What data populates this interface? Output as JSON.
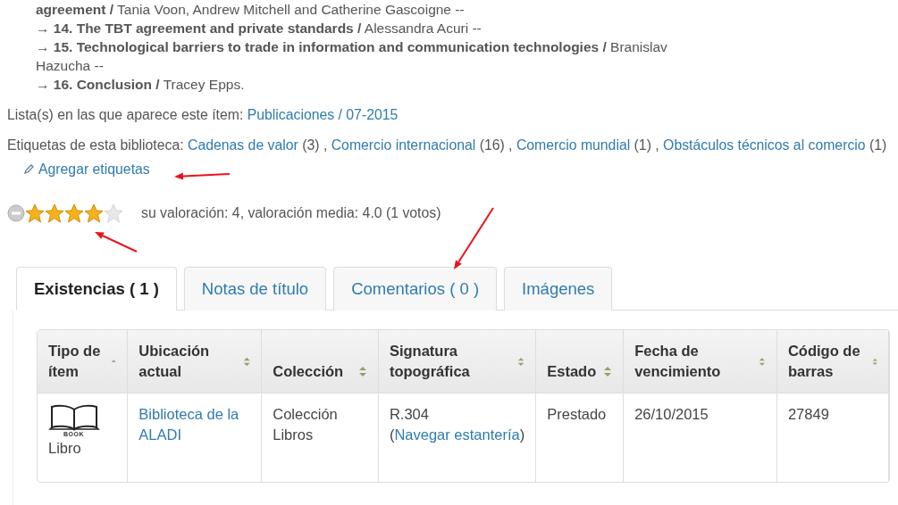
{
  "contents": [
    {
      "text": "**agreement /** Tania Voon, Andrew Mitchell and Catherine Gascoigne --"
    },
    {
      "text": "→ **14. The TBT agreement and private standards /** Alessandra Acuri --"
    },
    {
      "text": "→ **15. Technological barriers to trade in information and communication technologies /** Branislav Hazucha --"
    },
    {
      "text": "→ **16. Conclusion /** Tracey Epps."
    }
  ],
  "lists": {
    "label": "Lista(s) en las que aparece este ítem:",
    "link": "Publicaciones / 07-2015"
  },
  "tags": {
    "label": "Etiquetas de esta biblioteca:",
    "items": [
      {
        "name": "Cadenas de valor",
        "count": "(3) ,"
      },
      {
        "name": "Comercio internacional",
        "count": "(16) ,"
      },
      {
        "name": "Comercio mundial",
        "count": "(1) ,"
      },
      {
        "name": "Obstáculos técnicos al comercio",
        "count": "(1)"
      }
    ],
    "add_link": "Agregar etiquetas"
  },
  "rating": {
    "stars": 4,
    "text": "su valoración: 4, valoración media: 4.0 (1 votos)"
  },
  "tabs": [
    {
      "label": "Existencias ( 1 )",
      "selected": true
    },
    {
      "label": "Notas de título",
      "selected": false
    },
    {
      "label": "Comentarios ( 0 )",
      "selected": false
    },
    {
      "label": "Imágenes",
      "selected": false
    }
  ],
  "table": {
    "columns": [
      {
        "label": "Tipo de ítem",
        "sorted": true
      },
      {
        "label": "Ubicación actual",
        "sorted": false
      },
      {
        "label": "Colección",
        "sorted": false
      },
      {
        "label": "Signatura topográfica",
        "sorted": false
      },
      {
        "label": "Estado",
        "sorted": false
      },
      {
        "label": "Fecha de vencimiento",
        "sorted": false
      },
      {
        "label": "Código de barras",
        "sorted": false
      }
    ],
    "rows": [
      {
        "icon_label": "BOOK",
        "item_type": "Libro",
        "location": "Biblioteca de la ALADI",
        "collection": "Colección Libros",
        "call_number_prefix": "R.304 (",
        "browse_link": "Navegar estantería",
        "call_number_suffix": ")",
        "status": "Prestado",
        "due_date": "26/10/2015",
        "barcode": "27849"
      }
    ]
  },
  "annotation_arrows": [
    {
      "kind": "left"
    },
    {
      "kind": "up-left"
    },
    {
      "kind": "down"
    }
  ]
}
